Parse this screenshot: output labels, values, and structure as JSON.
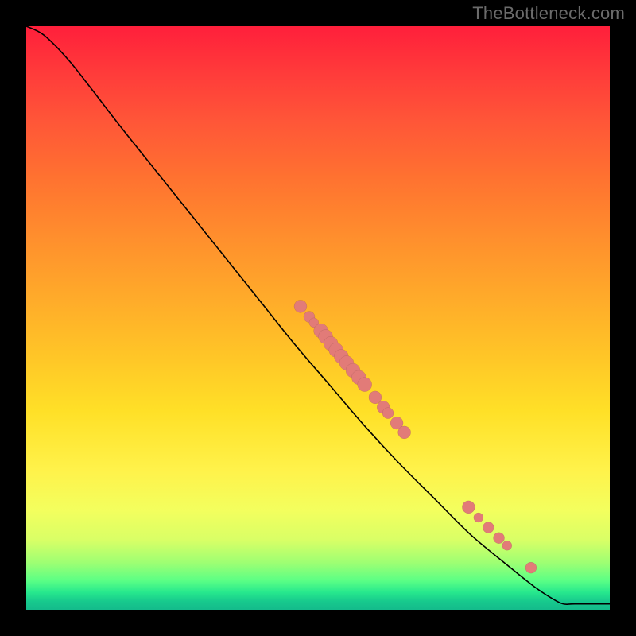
{
  "watermark": "TheBottleneck.com",
  "colors": {
    "dot_fill": "#e27b78",
    "curve_stroke": "#000000"
  },
  "chart_data": {
    "type": "line",
    "title": "",
    "xlabel": "",
    "ylabel": "",
    "xlim": [
      0,
      1
    ],
    "ylim": [
      0,
      1
    ],
    "description": "Monotone decreasing curve starting near top-left, descending roughly linearly across the plot, with a flat tail along the bottom to the right edge. Scatter points lie on the central and lower-right portion of the curve.",
    "curve": [
      {
        "x": 0.0,
        "y": 1.0
      },
      {
        "x": 0.03,
        "y": 0.985
      },
      {
        "x": 0.07,
        "y": 0.945
      },
      {
        "x": 0.11,
        "y": 0.895
      },
      {
        "x": 0.16,
        "y": 0.83
      },
      {
        "x": 0.22,
        "y": 0.755
      },
      {
        "x": 0.28,
        "y": 0.68
      },
      {
        "x": 0.34,
        "y": 0.605
      },
      {
        "x": 0.4,
        "y": 0.53
      },
      {
        "x": 0.46,
        "y": 0.455
      },
      {
        "x": 0.52,
        "y": 0.385
      },
      {
        "x": 0.58,
        "y": 0.315
      },
      {
        "x": 0.64,
        "y": 0.25
      },
      {
        "x": 0.7,
        "y": 0.19
      },
      {
        "x": 0.76,
        "y": 0.13
      },
      {
        "x": 0.82,
        "y": 0.08
      },
      {
        "x": 0.87,
        "y": 0.04
      },
      {
        "x": 0.9,
        "y": 0.02
      },
      {
        "x": 0.92,
        "y": 0.01
      },
      {
        "x": 0.94,
        "y": 0.01
      },
      {
        "x": 1.0,
        "y": 0.01
      }
    ],
    "points": [
      {
        "x": 0.47,
        "y": 0.52,
        "r": 8
      },
      {
        "x": 0.485,
        "y": 0.502,
        "r": 7
      },
      {
        "x": 0.493,
        "y": 0.492,
        "r": 6
      },
      {
        "x": 0.505,
        "y": 0.478,
        "r": 9
      },
      {
        "x": 0.513,
        "y": 0.468,
        "r": 9
      },
      {
        "x": 0.522,
        "y": 0.456,
        "r": 9
      },
      {
        "x": 0.531,
        "y": 0.445,
        "r": 9
      },
      {
        "x": 0.54,
        "y": 0.434,
        "r": 9
      },
      {
        "x": 0.549,
        "y": 0.423,
        "r": 9
      },
      {
        "x": 0.56,
        "y": 0.41,
        "r": 9
      },
      {
        "x": 0.57,
        "y": 0.398,
        "r": 9
      },
      {
        "x": 0.58,
        "y": 0.386,
        "r": 9
      },
      {
        "x": 0.598,
        "y": 0.364,
        "r": 8
      },
      {
        "x": 0.612,
        "y": 0.347,
        "r": 8
      },
      {
        "x": 0.62,
        "y": 0.337,
        "r": 7
      },
      {
        "x": 0.635,
        "y": 0.32,
        "r": 8
      },
      {
        "x": 0.648,
        "y": 0.304,
        "r": 8
      },
      {
        "x": 0.758,
        "y": 0.176,
        "r": 8
      },
      {
        "x": 0.775,
        "y": 0.158,
        "r": 6
      },
      {
        "x": 0.792,
        "y": 0.141,
        "r": 7
      },
      {
        "x": 0.81,
        "y": 0.123,
        "r": 7
      },
      {
        "x": 0.824,
        "y": 0.11,
        "r": 6
      },
      {
        "x": 0.865,
        "y": 0.072,
        "r": 7
      }
    ]
  }
}
